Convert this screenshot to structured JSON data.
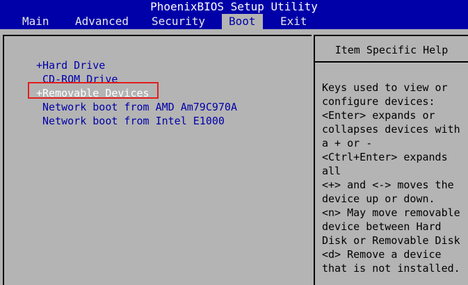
{
  "title": "PhoenixBIOS Setup Utility",
  "menu": [
    {
      "label": "Main"
    },
    {
      "label": "Advanced"
    },
    {
      "label": "Security"
    },
    {
      "label": "Boot"
    },
    {
      "label": "Exit"
    }
  ],
  "active_menu": "Boot",
  "boot_items": [
    {
      "label": "+Hard Drive"
    },
    {
      "label": " CD-ROM Drive"
    },
    {
      "label": "+Removable Devices"
    },
    {
      "label": " Network boot from AMD Am79C970A"
    },
    {
      "label": " Network boot from Intel E1000"
    }
  ],
  "selected_item": "+Removable Devices",
  "help": {
    "header": "Item Specific Help",
    "lines": [
      "Keys used to view or",
      "configure devices:",
      "<Enter> expands or",
      "collapses devices with",
      "a + or -",
      "<Ctrl+Enter> expands",
      "all",
      "<+> and <-> moves the",
      "device up or down.",
      "<n> May move removable",
      "device between Hard",
      "Disk or Removable Disk",
      "<d> Remove a device",
      "that is not installed."
    ]
  },
  "colors": {
    "bios_blue": "#0000a8",
    "background_gray": "#b4b4b4",
    "highlight_red": "#e21e1e"
  }
}
